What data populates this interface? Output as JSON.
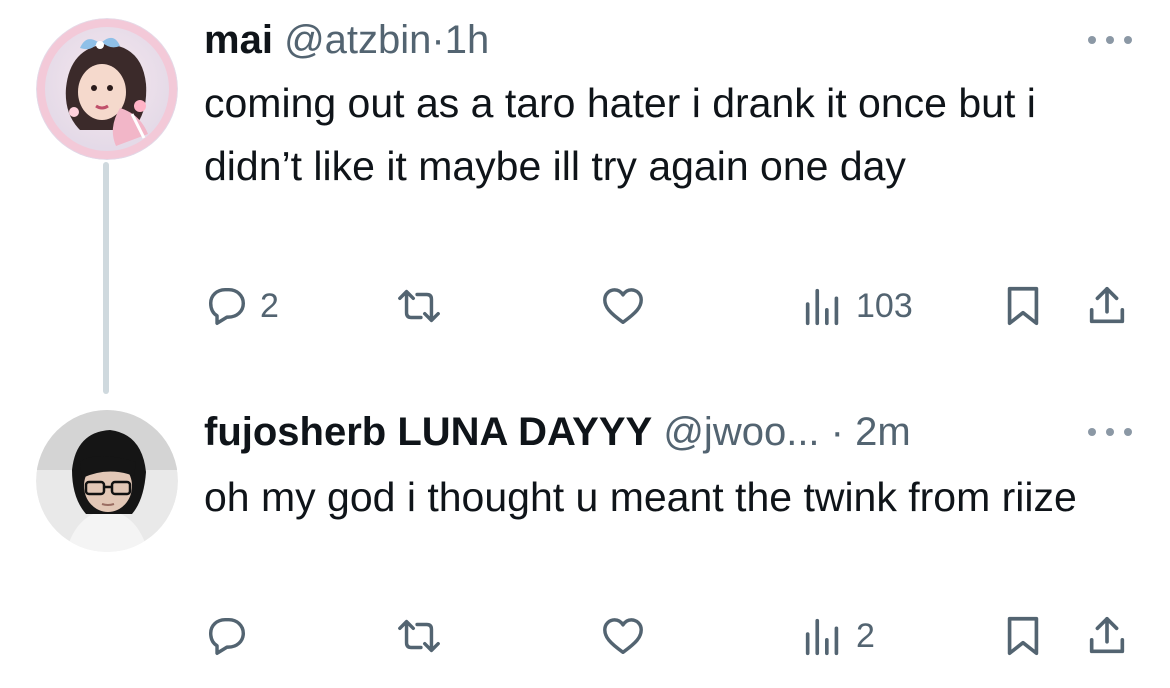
{
  "tweets": [
    {
      "name": "mai",
      "handle": "@atzbin",
      "separator": "·",
      "time": "1h",
      "text": "coming out as a taro hater i drank it once but i didn’t like it maybe ill try again one day",
      "actions": {
        "reply_count": "2",
        "retweet_count": "",
        "like_count": "",
        "views_count": "103"
      }
    },
    {
      "name": "fujosherb LUNA DAYYY",
      "handle": "@jwoo...",
      "separator": "·",
      "time": "2m",
      "text": "oh my god i thought u meant the twink from riize",
      "actions": {
        "reply_count": "",
        "retweet_count": "",
        "like_count": "",
        "views_count": "2"
      }
    }
  ],
  "icons": {
    "reply": "reply-icon",
    "retweet": "retweet-icon",
    "like": "heart-icon",
    "views": "views-icon",
    "bookmark": "bookmark-icon",
    "share": "share-icon",
    "more": "more-icon"
  },
  "colors": {
    "text": "#0f1419",
    "secondary": "#536471",
    "thread_line": "#cfd9de",
    "icon": "#536471"
  }
}
